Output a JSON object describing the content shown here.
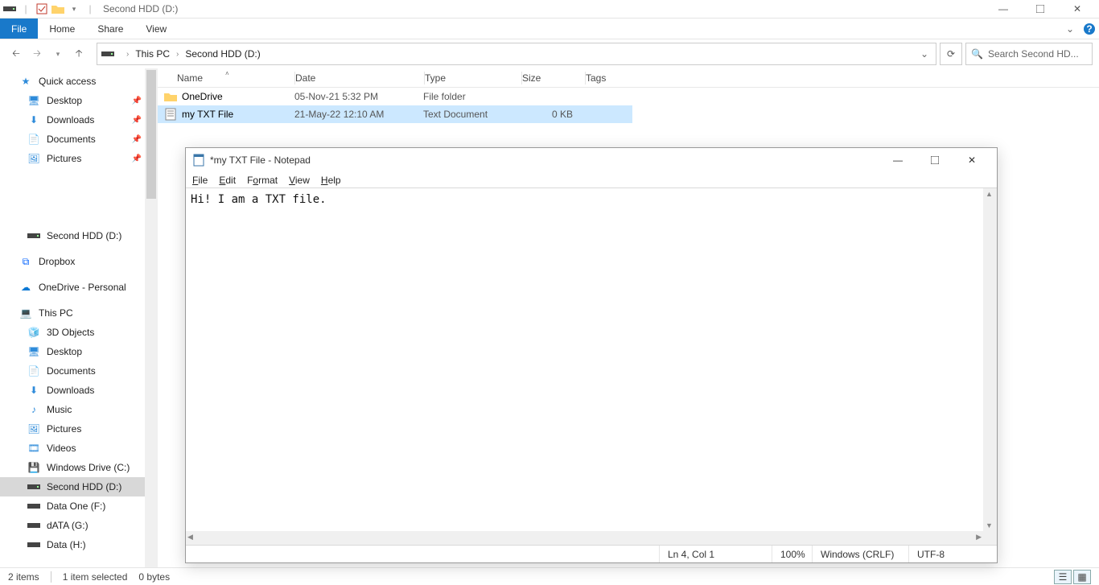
{
  "explorer": {
    "title": "Second HDD (D:)",
    "ribbon_tabs": {
      "file": "File",
      "home": "Home",
      "share": "Share",
      "view": "View"
    },
    "breadcrumb": {
      "a": "This PC",
      "b": "Second HDD (D:)"
    },
    "search_placeholder": "Search Second HD...",
    "columns": {
      "name": "Name",
      "date": "Date",
      "type": "Type",
      "size": "Size",
      "tags": "Tags"
    },
    "rows": [
      {
        "name": "OneDrive",
        "date": "05-Nov-21 5:32 PM",
        "type": "File folder",
        "size": ""
      },
      {
        "name": "my TXT File",
        "date": "21-May-22 12:10 AM",
        "type": "Text Document",
        "size": "0 KB"
      }
    ],
    "sidebar": {
      "quick_access": "Quick access",
      "qa_items": [
        {
          "label": "Desktop"
        },
        {
          "label": "Downloads"
        },
        {
          "label": "Documents"
        },
        {
          "label": "Pictures"
        },
        {
          "label": "Second HDD (D:)"
        },
        {
          "label": "Dropbox"
        },
        {
          "label": "OneDrive - Personal"
        }
      ],
      "this_pc": "This PC",
      "pc_items": [
        {
          "label": "3D Objects"
        },
        {
          "label": "Desktop"
        },
        {
          "label": "Documents"
        },
        {
          "label": "Downloads"
        },
        {
          "label": "Music"
        },
        {
          "label": "Pictures"
        },
        {
          "label": "Videos"
        },
        {
          "label": "Windows Drive (C:)"
        },
        {
          "label": "Second HDD (D:)"
        },
        {
          "label": "Data One (F:)"
        },
        {
          "label": "dATA (G:)"
        },
        {
          "label": "Data (H:)"
        }
      ]
    },
    "status": {
      "items": "2 items",
      "selected": "1 item selected",
      "bytes": "0 bytes"
    }
  },
  "notepad": {
    "title": "*my TXT File - Notepad",
    "menu_html": {
      "file": "<u>F</u>ile",
      "edit": "<u>E</u>dit",
      "format": "F<u>o</u>rmat",
      "view": "<u>V</u>iew",
      "help": "<u>H</u>elp"
    },
    "content": "Hi! I am a TXT file.",
    "status": {
      "pos": "Ln 4, Col 1",
      "zoom": "100%",
      "eol": "Windows (CRLF)",
      "enc": "UTF-8"
    }
  }
}
